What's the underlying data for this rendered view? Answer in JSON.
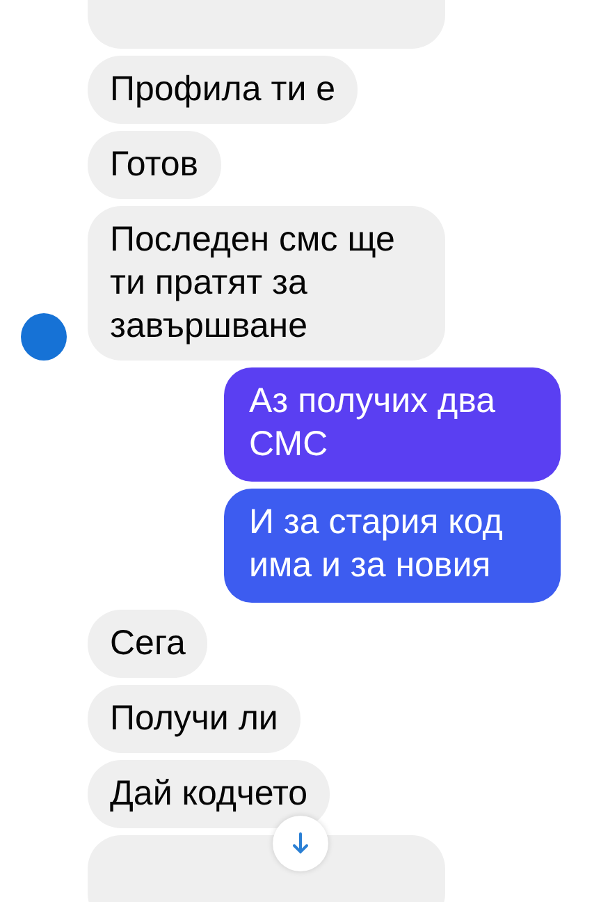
{
  "messages": [
    {
      "kind": "partial"
    },
    {
      "kind": "incoming",
      "text": "Профила ти е"
    },
    {
      "kind": "incoming",
      "text": "Готов"
    },
    {
      "kind": "incoming",
      "text": "Последен смс ще ти пратят за завършване",
      "avatar": true
    },
    {
      "kind": "outgoing",
      "text": "Аз получих два СМС",
      "color": "#5a3ff2"
    },
    {
      "kind": "outgoing",
      "text": "И за стария код има и за новия",
      "color": "#3d5cf0"
    },
    {
      "kind": "incoming",
      "text": "Сега"
    },
    {
      "kind": "incoming",
      "text": "Получи ли"
    },
    {
      "kind": "incoming",
      "text": "Дай кодчето"
    },
    {
      "kind": "partial",
      "scroll_down": true
    }
  ]
}
